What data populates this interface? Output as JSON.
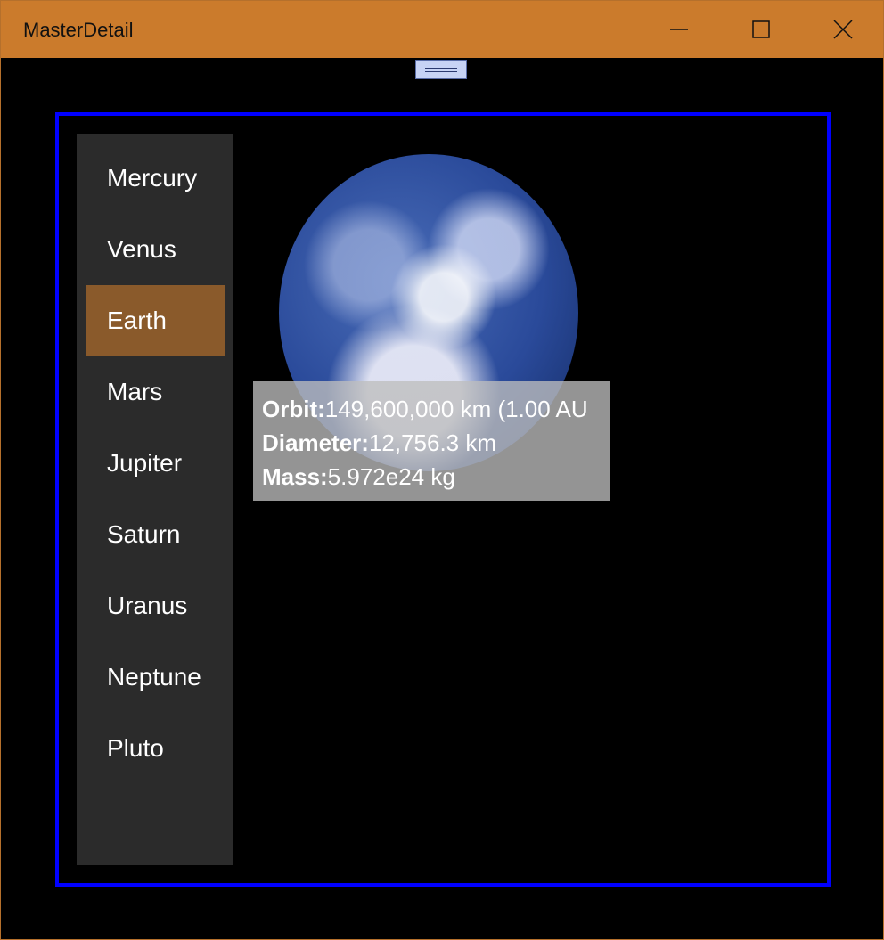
{
  "window": {
    "title": "MasterDetail"
  },
  "planets": [
    {
      "label": "Mercury"
    },
    {
      "label": "Venus"
    },
    {
      "label": "Earth"
    },
    {
      "label": "Mars"
    },
    {
      "label": "Jupiter"
    },
    {
      "label": "Saturn"
    },
    {
      "label": "Uranus"
    },
    {
      "label": "Neptune"
    },
    {
      "label": "Pluto"
    }
  ],
  "selected_planet": "Earth",
  "details": {
    "orbit_label": "Orbit:",
    "orbit_value": "149,600,000 km (1.00 AU",
    "diameter_label": "Diameter:",
    "diameter_value": "12,756.3 km",
    "mass_label": "Mass:",
    "mass_value": "5.972e24 kg"
  },
  "colors": {
    "titlebar": "#cb7b2c",
    "selection": "#8a5a2b",
    "frame_border": "#0000ff",
    "list_background": "#2b2b2b"
  }
}
